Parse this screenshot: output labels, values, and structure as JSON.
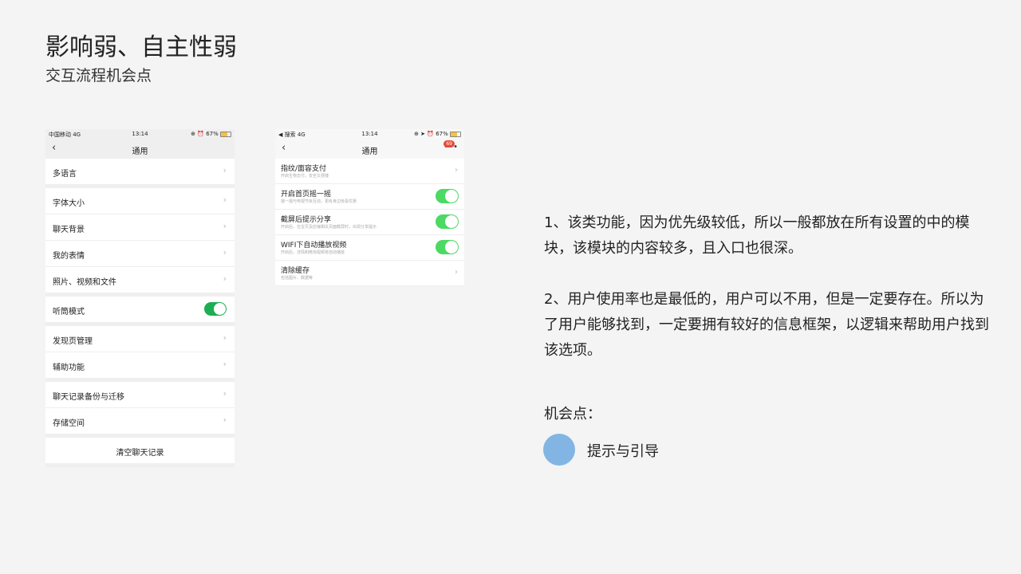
{
  "title": "影响弱、自主性弱",
  "subtitle": "交互流程机会点",
  "phone1": {
    "status": {
      "carrier": "中国移动  4G",
      "time": "13:14",
      "battery": "⊕ ⏰ 67%"
    },
    "nav_title": "通用",
    "groups": [
      [
        {
          "label": "多语言",
          "type": "chevron"
        }
      ],
      [
        {
          "label": "字体大小",
          "type": "chevron"
        },
        {
          "label": "聊天背景",
          "type": "chevron"
        },
        {
          "label": "我的表情",
          "type": "chevron"
        },
        {
          "label": "照片、视频和文件",
          "type": "chevron"
        }
      ],
      [
        {
          "label": "听筒模式",
          "type": "toggle"
        }
      ],
      [
        {
          "label": "发现页管理",
          "type": "chevron"
        },
        {
          "label": "辅助功能",
          "type": "chevron"
        }
      ],
      [
        {
          "label": "聊天记录备份与迁移",
          "type": "chevron"
        },
        {
          "label": "存储空间",
          "type": "chevron"
        }
      ],
      [
        {
          "label": "清空聊天记录",
          "type": "center"
        }
      ]
    ]
  },
  "phone2": {
    "status": {
      "carrier": "◀ 搜索  4G",
      "time": "13:14",
      "battery": "⊕ ➤ ⏰ 67%"
    },
    "nav_title": "通用",
    "more": "•••",
    "badge": "69",
    "rows": [
      {
        "label": "指纹/面容支付",
        "desc": "开启生物支付，安全又便捷",
        "type": "chevron"
      },
      {
        "label": "开启首页摇一摇",
        "desc": "摇一摇与电视节目互动，更有身边惊喜优惠",
        "type": "toggle"
      },
      {
        "label": "截屏后提示分享",
        "desc": "开启后，在宝贝及店铺相关页面截屏时，出现分享提示",
        "type": "toggle"
      },
      {
        "label": "WIFI下自动播放视频",
        "desc": "开启后，详情和微淘视频将自动播放",
        "type": "toggle"
      },
      {
        "label": "清除缓存",
        "desc": "包括图片、数据等",
        "type": "chevron"
      }
    ]
  },
  "paragraphs": [
    "1、该类功能，因为优先级较低，所以一般都放在所有设置的中的模块，该模块的内容较多，且入口也很深。",
    "2、用户使用率也是最低的，用户可以不用，但是一定要存在。所以为了用户能够找到，一定要拥有较好的信息框架，以逻辑来帮助用户找到该选项。"
  ],
  "opportunity_label": "机会点：",
  "legend": {
    "label": "提示与引导",
    "color": "#82b5e4"
  }
}
